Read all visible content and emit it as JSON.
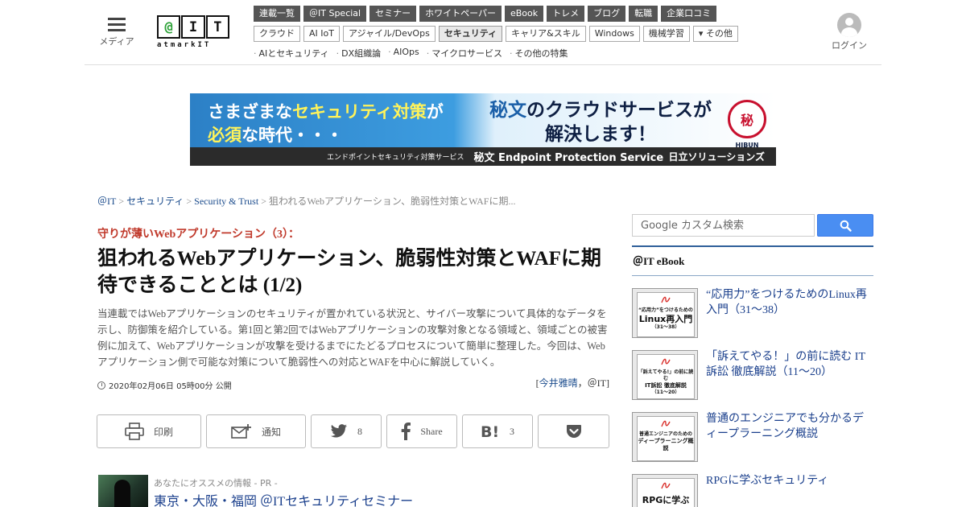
{
  "header": {
    "menu_label": "メディア",
    "logo": {
      "letters": [
        "@",
        "I",
        "T"
      ],
      "sub": "atmarkIT"
    },
    "nav_primary": [
      "連載一覧",
      "＠IT Special",
      "セミナー",
      "ホワイトペーパー",
      "eBook",
      "トレメ",
      "ブログ",
      "転職",
      "企業口コミ"
    ],
    "nav_secondary": [
      "クラウド",
      "AI IoT",
      "アジャイル/DevOps",
      "セキュリティ",
      "キャリア&スキル",
      "Windows",
      "機械学習",
      "▾ その他"
    ],
    "nav_secondary_active": "セキュリティ",
    "nav_topics": [
      "AIとセキュリティ",
      "DX組織論",
      "AIOps",
      "マイクロサービス",
      "その他の特集"
    ],
    "login_label": "ログイン"
  },
  "banner": {
    "left_line1_pre": "さまざまな",
    "left_line1_hl": "セキュリティ対策",
    "left_line1_post": "が",
    "left_line2_hl": "必須",
    "left_line2_post": "な時代・・・",
    "right_line1_hl": "秘文",
    "right_line1_post": "のクラウドサービスが",
    "right_line2": "解決します！",
    "seal_text": "秘",
    "seal_caption": "HIBUN",
    "strip_small": "エンドポイントセキュリティ対策サービス",
    "strip_product": "秘文 Endpoint Protection Service",
    "strip_company": "日立ソリューションズ"
  },
  "breadcrumb": {
    "items": [
      "＠IT",
      "セキュリティ",
      "Security & Trust"
    ],
    "current": "狙われるWebアプリケーション、脆弱性対策とWAFに期..."
  },
  "article": {
    "kicker": "守りが薄いWebアプリケーション（3）：",
    "title": "狙われるWebアプリケーション、脆弱性対策とWAFに期待できることとは (1/2)",
    "lead": "当連載ではWebアプリケーションのセキュリティが置かれている状況と、サイバー攻撃について具体的なデータを示し、防御策を紹介している。第1回と第2回ではWebアプリケーションの攻撃対象となる領域と、領域ごとの被害例に加えて、Webアプリケーションが攻撃を受けるまでにたどるプロセスについて簡単に整理した。今回は、Webアプリケーション側で可能な対策について脆弱性への対応とWAFを中心に解説していく。",
    "date": "2020年02月06日 05時00分 公開",
    "author_open": "[",
    "author_name": "今井雅晴",
    "author_rest": "，＠IT]"
  },
  "share": {
    "print_label": "印刷",
    "notify_label": "通知",
    "twitter_count": "8",
    "facebook_label": "Share",
    "hatena_count": "3"
  },
  "pr": {
    "label": "あなたにオススメの情報 - PR -",
    "title": "東京・大阪・福岡 ＠ITセキュリティセミナー"
  },
  "sidebar": {
    "search_placeholder": "Google カスタム検索",
    "heading": "＠IT eBook",
    "ebooks": [
      {
        "title": "“応用力”をつけるためのLinux再入門（31～38）",
        "cover_small": "“応用力”をつけるための",
        "cover_big": "Linux再入門",
        "cover_num": "（31～38）"
      },
      {
        "title": "「訴えてやる！」の前に読む IT訴訟 徹底解説（11～20）",
        "cover_small": "「訴えてやる!」の前に読む",
        "cover_big": "IT訴訟 徹底解説",
        "cover_num": "（11～20）"
      },
      {
        "title": "普通のエンジニアでも分かるディープラーニング概説",
        "cover_small": "普通エンジニアのための",
        "cover_big": "ディープラーニング概説",
        "cover_num": ""
      },
      {
        "title": "RPGに学ぶセキュリティ",
        "cover_small": "",
        "cover_big": "RPGに学ぶ",
        "cover_num": ""
      }
    ]
  },
  "colors": {
    "accent_red": "#c0392b",
    "link_blue": "#1a4b8c",
    "nav_dark": "#555555",
    "search_button": "#4a8ef2"
  }
}
